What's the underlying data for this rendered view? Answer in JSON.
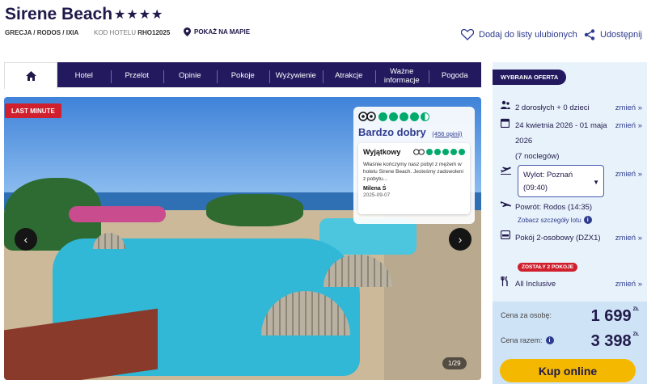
{
  "hotel": {
    "name": "Sirene Beach",
    "stars": "★★★★",
    "breadcrumb": "GRECJA / RODOS / IXIA",
    "code_label": "KOD HOTELU",
    "code_value": "RHO12025",
    "map_link": "POKAŻ NA MAPIE"
  },
  "actions": {
    "favorite": "Dodaj do listy ulubionych",
    "share": "Udostępnij"
  },
  "nav": {
    "items": [
      "Hotel",
      "Przelot",
      "Opinie",
      "Pokoje",
      "Wyżywienie",
      "Atrakcje",
      "Ważne informacje",
      "Pogoda"
    ]
  },
  "gallery": {
    "badge": "LAST MINUTE",
    "prev": "‹",
    "next": "›",
    "counter": "1/29"
  },
  "tripadvisor": {
    "rating_text": "Bardzo dobry",
    "review_count": "(456 opinii)",
    "review_title": "Wyjątkowy",
    "review_text": "Właśnie kończymy nasz pobyt z mężem w hotelu Sirene Beach. Jesteśmy zadowoleni z pobytu...",
    "review_author": "Milena Ś",
    "review_date": "2025-09-07"
  },
  "offer": {
    "tag": "WYBRANA OFERTA",
    "change": "zmień »",
    "travelers": "2 dorosłych + 0 dzieci",
    "dates": "24 kwietnia 2026 - 01 maja 2026",
    "nights": "(7 noclegów)",
    "departure": "Wylot: Poznań (09:40)",
    "return_flight": "Powrót: Rodos (14:35)",
    "flight_details": "Zobacz szczegóły lotu",
    "room": "Pokój 2-osobowy (DZX1)",
    "rooms_left": "ZOSTAŁY 2 POKOJE",
    "board": "All Inclusive",
    "price_per_person_label": "Cena za osobę:",
    "price_per_person": "1 699",
    "price_total_label": "Cena razem:",
    "price_total": "3 398",
    "currency": "ZŁ",
    "buy": "Kup online"
  }
}
